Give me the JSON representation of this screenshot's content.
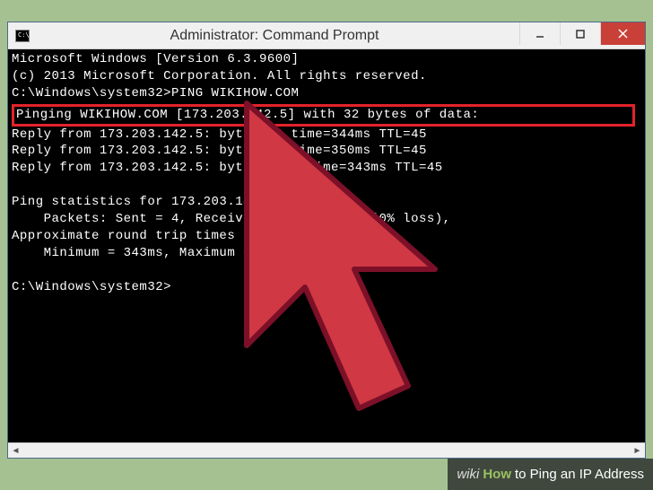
{
  "window": {
    "icon_text": "C:\\",
    "title": "Administrator: Command Prompt"
  },
  "terminal": {
    "line1": "Microsoft Windows [Version 6.3.9600]",
    "line2": "(c) 2013 Microsoft Corporation. All rights reserved.",
    "line3": "",
    "line4": "C:\\Windows\\system32>PING WIKIHOW.COM",
    "highlighted": "Pinging WIKIHOW.COM [173.203.142.5] with 32 bytes of data:",
    "reply1": "Reply from 173.203.142.5: byte =32 time=344ms TTL=45",
    "reply2": "Reply from 173.203.142.5: byte   2 time=350ms TTL=45",
    "reply3": "Reply from 173.203.142.5: byte       time=343ms TTL=45",
    "stats1": "Ping statistics for 173.203.14",
    "stats2": "    Packets: Sent = 4, Receive         t = 0 (0% loss),",
    "stats3": "Approximate round trip times i         nds:",
    "stats4": "    Minimum = 343ms, Maximum =          e = 346ms",
    "prompt": "C:\\Windows\\system32>"
  },
  "caption": {
    "brand_prefix": "wiki",
    "brand_suffix": "How",
    "text": " to Ping an IP Address"
  },
  "colors": {
    "cursor_fill": "#d03843",
    "cursor_stroke": "#7c1028",
    "highlight_border": "#e3222a"
  }
}
